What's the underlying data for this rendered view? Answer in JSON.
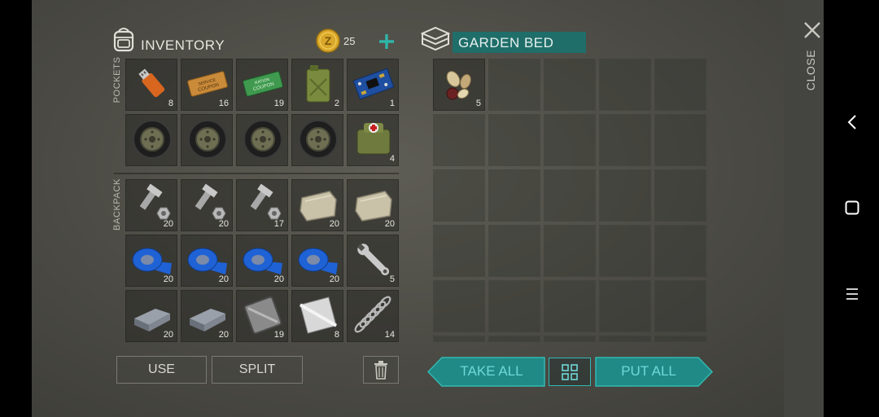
{
  "inventory": {
    "title": "INVENTORY",
    "coins": "25",
    "pockets_label": "POCKETS",
    "backpack_label": "BACKPACK",
    "pockets": [
      {
        "icon": "usb-stick-icon",
        "qty": "8"
      },
      {
        "icon": "coupon-icon",
        "qty": "16"
      },
      {
        "icon": "ration-coupon-icon",
        "qty": "19"
      },
      {
        "icon": "jerrycan-icon",
        "qty": "2"
      },
      {
        "icon": "circuit-board-icon",
        "qty": "1"
      },
      {
        "icon": "wheel-icon",
        "qty": ""
      },
      {
        "icon": "wheel-icon",
        "qty": ""
      },
      {
        "icon": "wheel-icon",
        "qty": ""
      },
      {
        "icon": "wheel-icon",
        "qty": ""
      },
      {
        "icon": "medkit-bag-icon",
        "qty": "4"
      }
    ],
    "backpack": [
      {
        "icon": "bolt-nut-icon",
        "qty": "20"
      },
      {
        "icon": "bolt-nut-icon",
        "qty": "20"
      },
      {
        "icon": "bolt-nut-icon",
        "qty": "17"
      },
      {
        "icon": "stone-icon",
        "qty": "20"
      },
      {
        "icon": "stone-icon",
        "qty": "20"
      },
      {
        "icon": "tape-icon",
        "qty": "20"
      },
      {
        "icon": "tape-icon",
        "qty": "20"
      },
      {
        "icon": "tape-icon",
        "qty": "20"
      },
      {
        "icon": "tape-icon",
        "qty": "20"
      },
      {
        "icon": "wrench-icon",
        "qty": "5"
      },
      {
        "icon": "iron-bar-icon",
        "qty": "20"
      },
      {
        "icon": "iron-bar-icon",
        "qty": "20"
      },
      {
        "icon": "metal-plate-icon",
        "qty": "19"
      },
      {
        "icon": "steel-sheet-icon",
        "qty": "8"
      },
      {
        "icon": "spring-icon",
        "qty": "14"
      }
    ],
    "use_label": "USE",
    "split_label": "SPLIT"
  },
  "container": {
    "title": "GARDEN BED",
    "items": [
      {
        "icon": "seeds-icon",
        "qty": "5"
      }
    ],
    "take_all_label": "TAKE ALL",
    "put_all_label": "PUT ALL"
  },
  "close_label": "CLOSE",
  "colors": {
    "accent_teal": "#1f8a86",
    "accent_teal_text": "#6fd8d8",
    "coin_gold": "#d9a72a"
  }
}
